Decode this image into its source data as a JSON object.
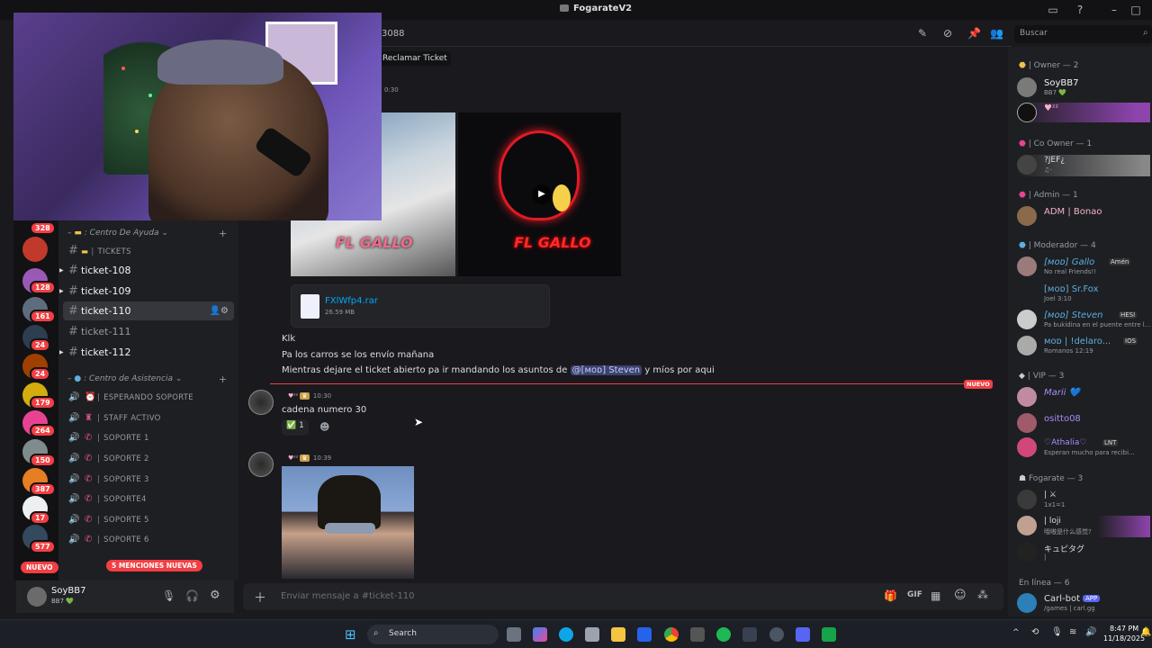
{
  "window": {
    "title": "FogarateV2"
  },
  "header": {
    "channel_id_fragment": "3088",
    "claim_button": "Reclamar Ticket",
    "timestamp_top": "0:30"
  },
  "search": {
    "placeholder": "Buscar"
  },
  "attachment": {
    "filename": "FXlWfp4.rar",
    "size": "26.59 MB"
  },
  "servers": {
    "badges": [
      "328",
      "128",
      "161",
      "24",
      "24",
      "179",
      "264",
      "150",
      "387",
      "17",
      "577"
    ],
    "new_label": "NUEVO"
  },
  "channels": {
    "cat1": "Centro De Ayuda",
    "tickets_label": "TICKETS",
    "text": [
      "ticket-108",
      "ticket-109",
      "ticket-110",
      "ticket-111",
      "ticket-112"
    ],
    "cat2": "Centro de Asistencia",
    "voice": [
      "ESPERANDO SOPORTE",
      "STAFF ACTIVO",
      "SOPORTE 1",
      "SOPORTE 2",
      "SOPORTE 3",
      "SOPORTE4",
      "SOPORTE 5",
      "SOPORTE 6"
    ],
    "mentions_pill": "5 MENCIONES NUEVAS"
  },
  "user": {
    "name": "SoyBB7",
    "status": "BB7 💚"
  },
  "messages": {
    "m1": "Klk",
    "m2": "Pa los carros se los envío mañana",
    "m3a": "Mientras dejare el ticket abierto pa ir mandando los asuntos de",
    "m3_mention": "@[ᴍᴏᴅ] Steven",
    "m3b": "y míos por aqui",
    "new_divider": "NUEVO",
    "m4_time": "10:30",
    "m4_text": "cadena numero 30",
    "m4_reaction_count": "1",
    "m5_time": "10:39",
    "m4_author": "♥ᶻᶻ",
    "m5_author": "♥ᶻᶻ"
  },
  "composer": {
    "placeholder": "Enviar mensaje a #ticket-110"
  },
  "members": {
    "owner_h": "| Owner — 2",
    "owner": [
      {
        "name": "SoyBB7",
        "sub": "BB7 💚"
      },
      {
        "name": "♥ᶻᶻ",
        "sub": ""
      }
    ],
    "coowner_h": "| Co Owner — 1",
    "coowner": [
      {
        "name": "?JEF¿",
        "sub": "♫-"
      }
    ],
    "admin_h": "| Admin — 1",
    "admin": [
      {
        "name": "ADM | Bonao",
        "sub": ""
      }
    ],
    "mod_h": "| Moderador — 4",
    "mods": [
      {
        "name": "[ᴍᴏᴅ] Gallo",
        "sub": "No real Friends!!"
      },
      {
        "name": "[ᴍᴏᴅ] Sr.Fox",
        "sub": "Joel 3:10"
      },
      {
        "name": "[ᴍᴏᴅ] Steven",
        "sub": "Pa bukidina en el puente entre l..."
      },
      {
        "name": "ᴍᴏᴅ | !delaro...",
        "sub": "Romanos 12:19"
      }
    ],
    "vip_h": "| VIP — 3",
    "vip": [
      {
        "name": "Marii 💙",
        "sub": ""
      },
      {
        "name": "ositto08",
        "sub": ""
      },
      {
        "name": "♡Athalia♡",
        "sub": "Esperan mucho para recibi..."
      }
    ],
    "fog_h": "Fogarate — 3",
    "fog": [
      {
        "name": "| ⚔",
        "sub": "1x1=1"
      },
      {
        "name": "| loji",
        "sub": "哦嗷是什么感觉?"
      },
      {
        "name": "キュピタグ",
        "sub": "|"
      }
    ],
    "online_h": "En línea — 6",
    "online": [
      {
        "name": "Carl-bot",
        "sub": "/games | carl.gg"
      }
    ],
    "tags": {
      "gallo": "Amén",
      "steven": "HESI",
      "delaro": "IOS",
      "athalia": "LNT",
      "carl": "APP"
    }
  },
  "taskbar": {
    "search": "Search",
    "time": "8:47 PM",
    "date": "11/18/2025"
  }
}
